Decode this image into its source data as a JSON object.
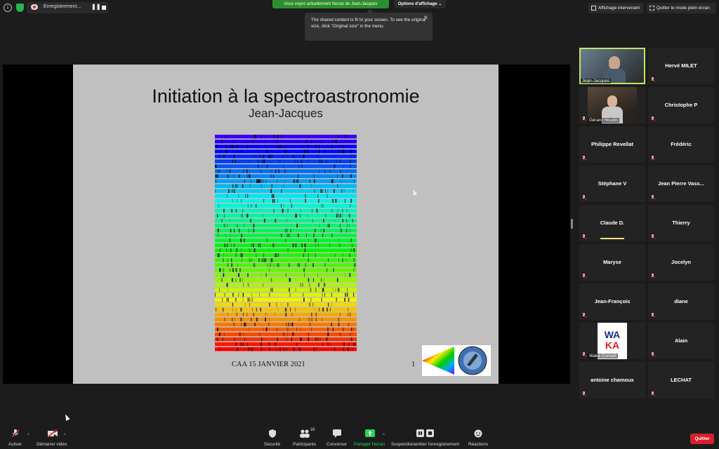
{
  "recording": {
    "label": "Enregistrement...",
    "pause_glyph": "❚❚"
  },
  "top": {
    "share_banner": "Vous voyez actuellement l'écran de Jean-Jacques",
    "view_options": "Options d'affichage ⌄",
    "tooltip_text": "The shared content is fit to your screen. To see the original size, click \"Original size\" in the menu.",
    "tooltip_close": "✕",
    "speaker_view": "Affichage intervenant",
    "exit_fullscreen": "Quitter le mode plein écran"
  },
  "slide": {
    "title": "Initiation à la spectroastronomie",
    "subtitle": "Jean-Jacques",
    "footer": "CAA  15 JANVIER 2021",
    "page": "1"
  },
  "participants": [
    {
      "name": "Jean-Jacques",
      "video": true
    },
    {
      "name": "Hervé MILET",
      "video": false
    },
    {
      "name": "Gérard Houdin",
      "video": true
    },
    {
      "name": "Christophe P",
      "video": false
    },
    {
      "name": "Philippe Revellat",
      "video": false
    },
    {
      "name": "Frédéric",
      "video": false
    },
    {
      "name": "Stéphane V",
      "video": false
    },
    {
      "name": "Jean Pierre Vass...",
      "video": false
    },
    {
      "name": "Claude D.",
      "video": false
    },
    {
      "name": "Thierry",
      "video": false
    },
    {
      "name": "Maryse",
      "video": false
    },
    {
      "name": "Jocelyn",
      "video": false
    },
    {
      "name": "Jean-François",
      "video": false
    },
    {
      "name": "diane",
      "video": false
    },
    {
      "name": "Waka Conseil",
      "video": true
    },
    {
      "name": "Alain",
      "video": false
    },
    {
      "name": "antoine chamoux",
      "video": false
    },
    {
      "name": "LECHAT",
      "video": false
    }
  ],
  "waka_logo": {
    "line1": "WA",
    "line2": "KA"
  },
  "toolbar": {
    "mute": "Activer",
    "video": "Démarrer vidéo",
    "security": "Sécurité",
    "participants": "Participants",
    "participants_count": "18",
    "chat": "Converser",
    "share": "Partager l'écran",
    "recording": "Suspendre/arrêter l'enregistrement",
    "reactions": "Réactions",
    "leave": "Quitter"
  },
  "colors": {
    "accent_green": "#2d8e2d",
    "active_speaker": "#c9e265",
    "leave_red": "#d6202b"
  }
}
